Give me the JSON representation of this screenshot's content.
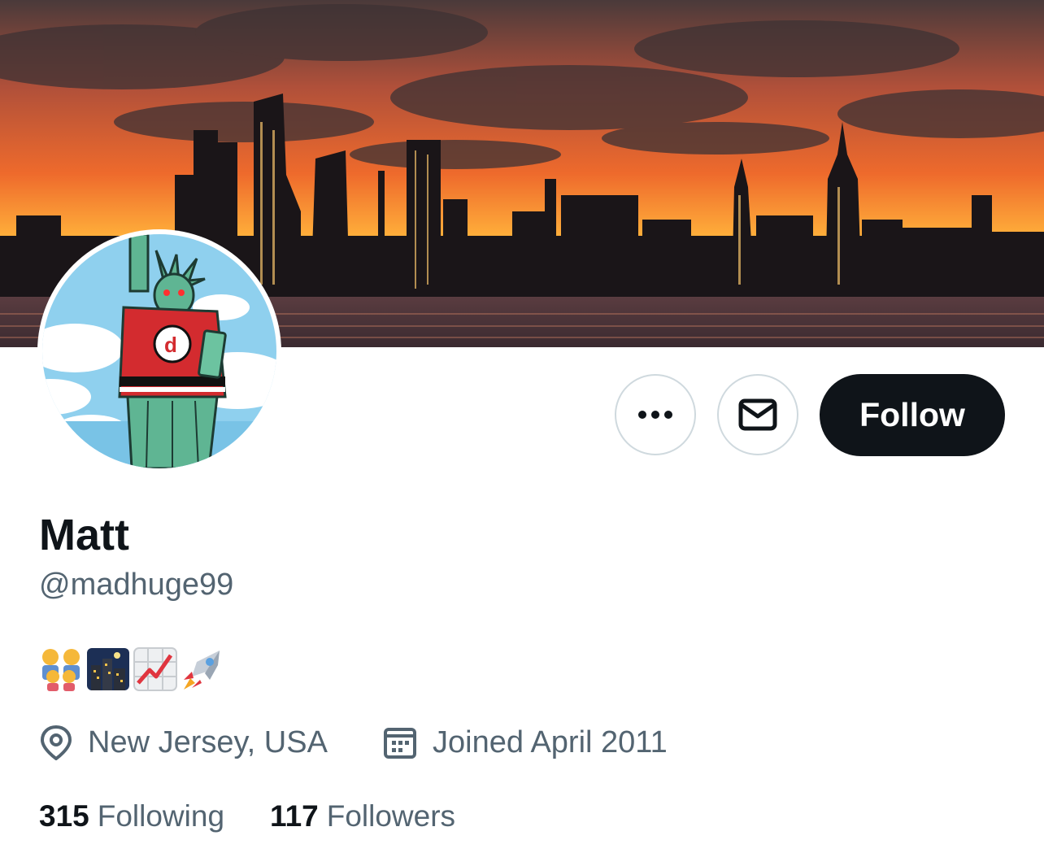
{
  "profile": {
    "display_name": "Matt",
    "handle": "@madhuge99",
    "bio_emojis": [
      "family-emoji",
      "night-city-emoji",
      "chart-increasing-emoji",
      "rocket-emoji"
    ],
    "location": "New Jersey, USA",
    "joined": "Joined April 2011"
  },
  "actions": {
    "more_icon": "more-icon",
    "message_icon": "mail-icon",
    "follow_label": "Follow"
  },
  "stats": {
    "following_count": "315",
    "following_label": "Following",
    "followers_count": "117",
    "followers_label": "Followers"
  },
  "colors": {
    "primary_text": "#0f1419",
    "secondary_text": "#536471",
    "button_border": "#cfd9de",
    "follow_bg": "#0f1419"
  }
}
